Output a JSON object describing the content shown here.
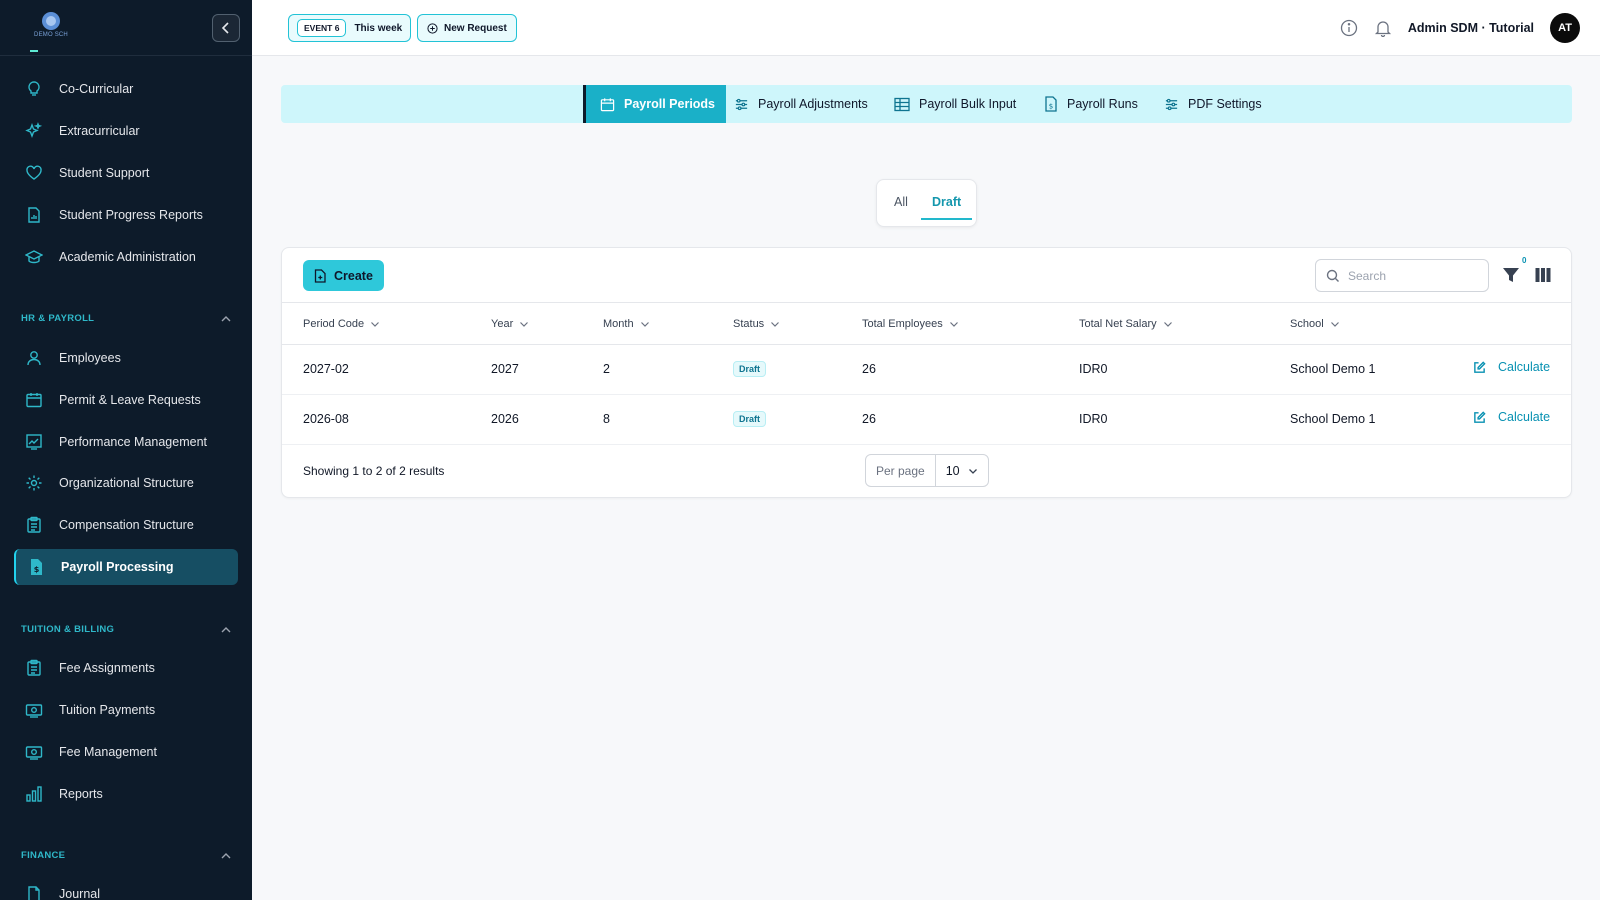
{
  "sidebar": {
    "logo_text": "DEMO SCH",
    "items_top": [
      {
        "label": "Co-Curricular",
        "icon": "lightbulb-icon"
      },
      {
        "label": "Extracurricular",
        "icon": "sparkles-icon"
      },
      {
        "label": "Student Support",
        "icon": "heart-icon"
      },
      {
        "label": "Student Progress Reports",
        "icon": "document-chart-icon"
      },
      {
        "label": "Academic Administration",
        "icon": "academic-cap-icon"
      }
    ],
    "section_hr": "HR & PAYROLL",
    "items_hr": [
      {
        "label": "Employees",
        "icon": "user-icon"
      },
      {
        "label": "Permit & Leave Requests",
        "icon": "calendar-icon"
      },
      {
        "label": "Performance Management",
        "icon": "chart-icon"
      },
      {
        "label": "Organizational Structure",
        "icon": "gear-icon"
      },
      {
        "label": "Compensation Structure",
        "icon": "clipboard-icon"
      },
      {
        "label": "Payroll Processing",
        "icon": "document-dollar-icon"
      }
    ],
    "section_tuition": "TUITION & BILLING",
    "items_tuition": [
      {
        "label": "Fee Assignments",
        "icon": "clipboard-icon"
      },
      {
        "label": "Tuition Payments",
        "icon": "banknote-icon"
      },
      {
        "label": "Fee Management",
        "icon": "banknote-icon"
      },
      {
        "label": "Reports",
        "icon": "bar-chart-icon"
      }
    ],
    "section_finance": "FINANCE",
    "items_finance": [
      {
        "label": "Journal",
        "icon": "document-icon"
      }
    ]
  },
  "topbar": {
    "event_tag": "EVENT 6",
    "event_week": "This week",
    "new_request": "New Request",
    "user_name": "Admin SDM · Tutorial",
    "avatar_initials": "AT"
  },
  "tabs": [
    {
      "label": "Payroll Periods",
      "active": true
    },
    {
      "label": "Payroll Adjustments",
      "active": false
    },
    {
      "label": "Payroll Bulk Input",
      "active": false
    },
    {
      "label": "Payroll Runs",
      "active": false
    },
    {
      "label": "PDF Settings",
      "active": false
    }
  ],
  "filter_tabs": {
    "all": "All",
    "draft": "Draft",
    "active": "Draft"
  },
  "table": {
    "create_label": "Create",
    "search_placeholder": "Search",
    "filter_count": "0",
    "columns": [
      "Period Code",
      "Year",
      "Month",
      "Status",
      "Total Employees",
      "Total Net Salary",
      "School"
    ],
    "rows": [
      {
        "period_code": "2027-02",
        "year": "2027",
        "month": "2",
        "status": "Draft",
        "total_employees": "26",
        "total_net_salary": "IDR0",
        "school": "School Demo 1",
        "action": "Calculate"
      },
      {
        "period_code": "2026-08",
        "year": "2026",
        "month": "8",
        "status": "Draft",
        "total_employees": "26",
        "total_net_salary": "IDR0",
        "school": "School Demo 1",
        "action": "Calculate"
      }
    ],
    "showing_text": "Showing 1 to 2 of 2 results",
    "per_page_label": "Per page",
    "per_page_value": "10"
  },
  "colors": {
    "accent": "#2ec8da",
    "sidebar_bg": "#0d1b2a",
    "tab_bar_bg": "#cef6fb",
    "active_tab": "#1ab0c8"
  }
}
